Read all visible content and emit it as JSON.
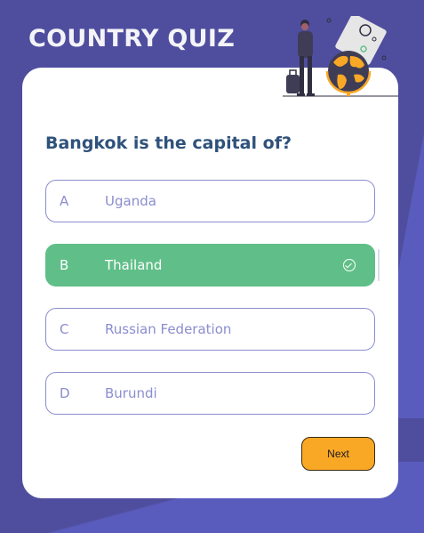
{
  "header": {
    "title": "COUNTRY QUIZ"
  },
  "quiz": {
    "question": "Bangkok is the capital of?",
    "options": [
      {
        "letter": "A",
        "label": "Uganda",
        "selected": false
      },
      {
        "letter": "B",
        "label": "Thailand",
        "selected": true
      },
      {
        "letter": "C",
        "label": "Russian Federation",
        "selected": false
      },
      {
        "letter": "D",
        "label": "Burundi",
        "selected": false
      }
    ],
    "next_label": "Next"
  },
  "colors": {
    "background": "#4f4e9e",
    "accent_shape": "#5a5cbd",
    "question_text": "#2f527b",
    "option_border": "#8b8dcf",
    "correct": "#60bf88",
    "next_button": "#f9a826"
  },
  "icons": {
    "illustration": "traveler-with-globe-illustration",
    "selected_marker": "check-circle-icon"
  }
}
